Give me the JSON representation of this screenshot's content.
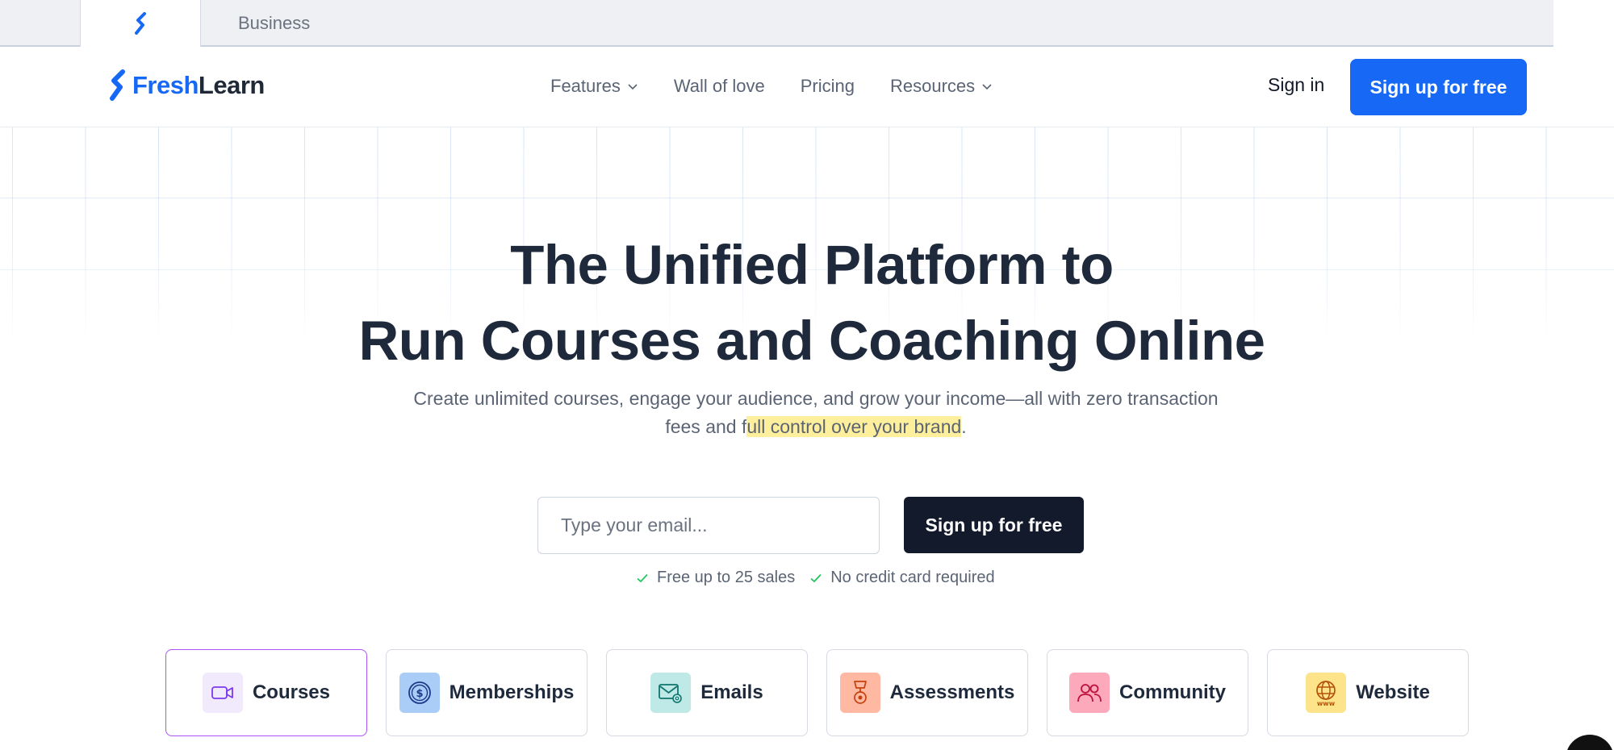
{
  "tabstrip": {
    "active_tab_icon": "freshlearn-logo-icon",
    "business_tab": "Business"
  },
  "header": {
    "logo": {
      "fresh": "Fresh",
      "learn": "Learn",
      "brand_color": "#1769f5"
    },
    "nav": [
      {
        "label": "Features",
        "dropdown": true
      },
      {
        "label": "Wall of love",
        "dropdown": false
      },
      {
        "label": "Pricing",
        "dropdown": false
      },
      {
        "label": "Resources",
        "dropdown": true
      }
    ],
    "sign_in": "Sign in",
    "sign_up": "Sign up for free"
  },
  "hero": {
    "title_line1": "The Unified Platform to",
    "title_line2": "Run Courses and Coaching Online",
    "subtitle_line1": "Create unlimited courses, engage your audience, and grow your income—all with zero transaction",
    "subtitle_pre": "fees and f",
    "subtitle_highlight": "ull control over your brand",
    "subtitle_post": "."
  },
  "form": {
    "email_placeholder": "Type your email...",
    "email_value": "",
    "submit": "Sign up for free",
    "checks": [
      "Free up to 25 sales",
      "No credit card required"
    ],
    "check_color": "#22c55e"
  },
  "features": [
    {
      "label": "Courses",
      "icon": "video-camera-icon",
      "bg": "#f1eafd",
      "color": "#7c3aed",
      "active": true
    },
    {
      "label": "Memberships",
      "icon": "dollar-coin-icon",
      "bg": "#a9cdf7",
      "color": "#1e3a8a",
      "active": false
    },
    {
      "label": "Emails",
      "icon": "email-at-icon",
      "bg": "#bfe9e6",
      "color": "#0f766e",
      "active": false
    },
    {
      "label": "Assessments",
      "icon": "trophy-icon",
      "bg": "#ffb9a3",
      "color": "#c2410c",
      "active": false
    },
    {
      "label": "Community",
      "icon": "people-icon",
      "bg": "#fca9bb",
      "color": "#be123c",
      "active": false
    },
    {
      "label": "Website",
      "icon": "globe-www-icon",
      "bg": "#fde38a",
      "color": "#b45309",
      "active": false
    }
  ]
}
